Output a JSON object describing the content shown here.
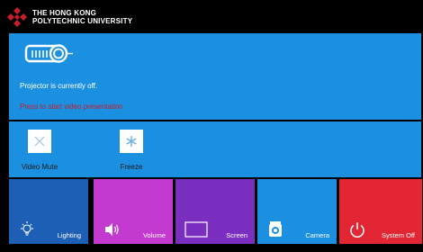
{
  "header": {
    "brand_line1": "THE HONG KONG",
    "brand_line2": "POLYTECHNIC UNIVERSITY",
    "logo_icon": "polyu-logo-icon",
    "logo_color": "#c81e2a"
  },
  "main": {
    "icon": "projector-icon",
    "status": "Projector is currently off.",
    "prompt": "Press to start video presentation",
    "bg_color": "#1b8fe0",
    "prompt_color": "#c81e2a"
  },
  "controls": [
    {
      "label": "Video Mute",
      "icon": "close-icon"
    },
    {
      "label": "Freeze",
      "icon": "snowflake-icon"
    }
  ],
  "tiles": [
    {
      "label": "Lighting",
      "icon": "lightbulb-icon",
      "color": "#1c5fb5"
    },
    {
      "label": "Volume",
      "icon": "speaker-icon",
      "color": "#c43ad0"
    },
    {
      "label": "Screen",
      "icon": "screen-icon",
      "color": "#7a2fc0"
    },
    {
      "label": "Camera",
      "icon": "camera-icon",
      "color": "#1b8fe0"
    },
    {
      "label": "System Off",
      "icon": "power-icon",
      "color": "#e32633"
    }
  ]
}
